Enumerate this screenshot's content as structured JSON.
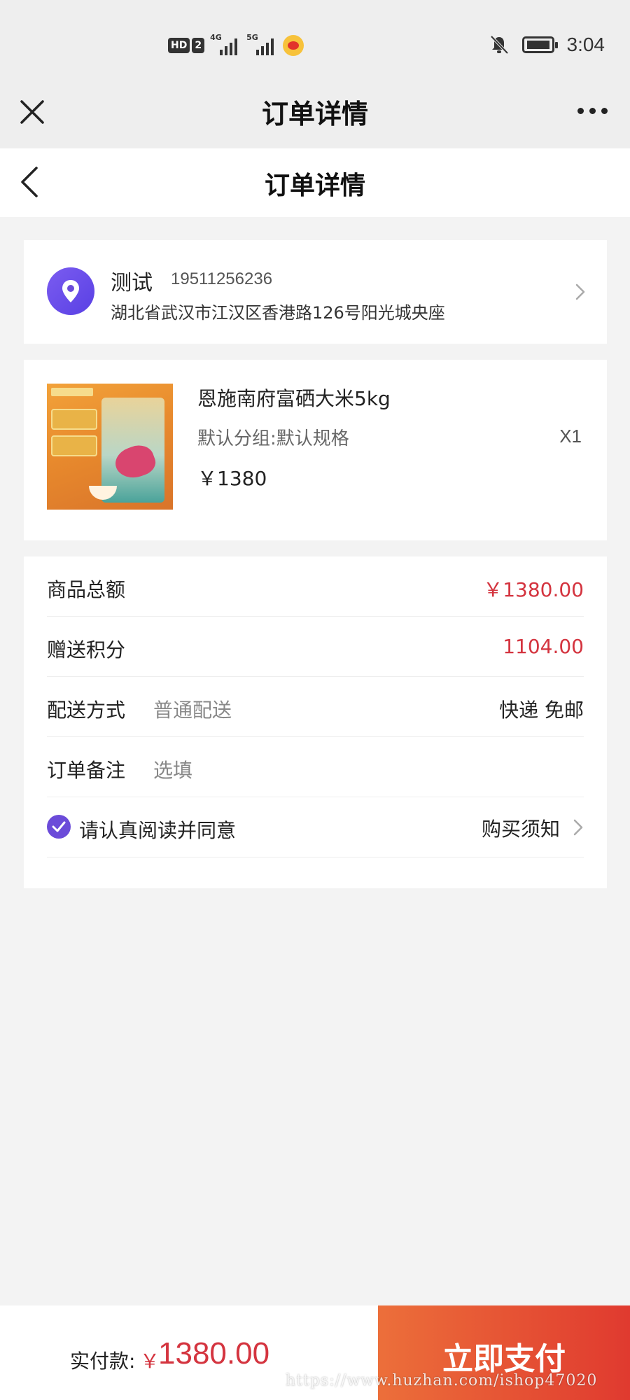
{
  "status_bar": {
    "hd_label": "HD",
    "hd_num": "2",
    "sim1_gen": "4G",
    "sim2_gen": "5G",
    "time": "3:04"
  },
  "wechat_header": {
    "title": "订单详情"
  },
  "page_header": {
    "title": "订单详情"
  },
  "address": {
    "name": "测试",
    "phone": "19511256236",
    "full_address": "湖北省武汉市江汉区香港路126号阳光城央座"
  },
  "product": {
    "name": "恩施南府富硒大米5kg",
    "spec": "默认分组:默认规格",
    "quantity": "X1",
    "price": "￥1380"
  },
  "summary": {
    "goods_total_label": "商品总额",
    "goods_total_value": "￥1380.00",
    "points_label": "赠送积分",
    "points_value": "1104.00",
    "delivery_label": "配送方式",
    "delivery_type": "普通配送",
    "delivery_value": "快递 免邮",
    "remark_label": "订单备注",
    "remark_placeholder": "选填",
    "agree_text": "请认真阅读并同意",
    "notice_link": "购买须知"
  },
  "bottom_bar": {
    "pay_label": "实付款:",
    "currency": "￥",
    "amount": "1380.00",
    "pay_button": "立即支付"
  },
  "watermark": "https://www.huzhan.com/ishop47020",
  "colors": {
    "price_red": "#d4343f",
    "accent_purple": "#6b4bd9",
    "pay_button_start": "#ec6f3a",
    "pay_button_end": "#e03a2f"
  },
  "icons": [
    "close-icon",
    "more-icon",
    "back-icon",
    "location-pin-icon",
    "chevron-right-icon",
    "checkbox-checked-icon",
    "bell-mute-icon",
    "battery-icon",
    "weibo-icon"
  ]
}
